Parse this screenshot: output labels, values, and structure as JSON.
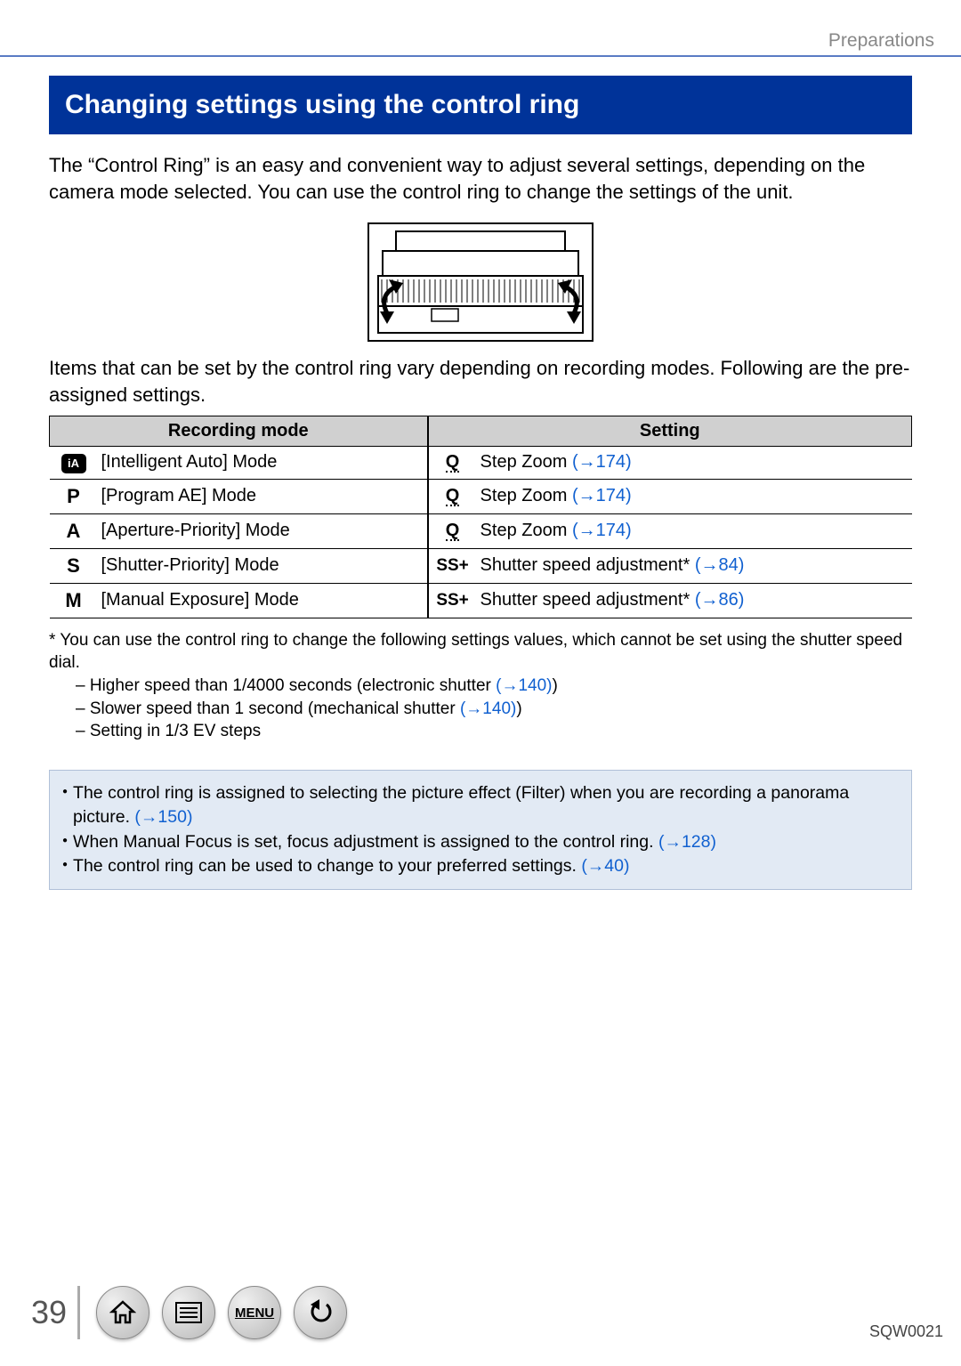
{
  "breadcrumb": "Preparations",
  "title": "Changing settings using the control ring",
  "intro": "The “Control Ring” is an easy and convenient way to adjust several settings, depending on the camera mode selected. You can use the control ring to change the settings of the unit.",
  "sub": "Items that can be set by the control ring vary depending on recording modes. Following are the pre-assigned settings.",
  "headers": {
    "mode": "Recording mode",
    "setting": "Setting"
  },
  "rows": [
    {
      "glyph": "iA",
      "glyph_type": "badge",
      "mode": "[Intelligent Auto] Mode",
      "icon": "zoom",
      "setting": "Step Zoom",
      "link": "(→174)"
    },
    {
      "glyph": "P",
      "glyph_type": "letter",
      "mode": "[Program AE] Mode",
      "icon": "zoom",
      "setting": "Step Zoom",
      "link": "(→174)"
    },
    {
      "glyph": "A",
      "glyph_type": "letter",
      "mode": "[Aperture-Priority] Mode",
      "icon": "zoom",
      "setting": "Step Zoom",
      "link": "(→174)"
    },
    {
      "glyph": "S",
      "glyph_type": "letter",
      "mode": "[Shutter-Priority] Mode",
      "icon": "ss",
      "setting": "Shutter speed adjustment*",
      "link": "(→84)"
    },
    {
      "glyph": "M",
      "glyph_type": "letter",
      "mode": "[Manual Exposure] Mode",
      "icon": "ss",
      "setting": "Shutter speed adjustment*",
      "link": "(→86)"
    }
  ],
  "footnote_lead": "* You can use the control ring to change the following settings values, which cannot be set using the shutter speed dial.",
  "footnote_items": [
    {
      "pre": "–  Higher speed than 1/4000 seconds (electronic shutter ",
      "link": "(→140)",
      "post": ")"
    },
    {
      "pre": "–  Slower speed than 1 second (mechanical shutter ",
      "link": "(→140)",
      "post": ")"
    },
    {
      "pre": "–  Setting in 1/3 EV steps",
      "link": "",
      "post": ""
    }
  ],
  "info": [
    {
      "pre": "The control ring is assigned to selecting the picture effect (Filter) when you are recording a panorama picture. ",
      "link": "(→150)",
      "post": ""
    },
    {
      "pre": "When Manual Focus is set, focus adjustment is assigned to the control ring. ",
      "link": "(→128)",
      "post": ""
    },
    {
      "pre": "The control ring can be used to change to your preferred settings. ",
      "link": "(→40)",
      "post": ""
    }
  ],
  "page_number": "39",
  "doc_id": "SQW0021",
  "nav": {
    "home": "Home",
    "contents": "Contents",
    "menu": "MENU",
    "back": "Back"
  }
}
